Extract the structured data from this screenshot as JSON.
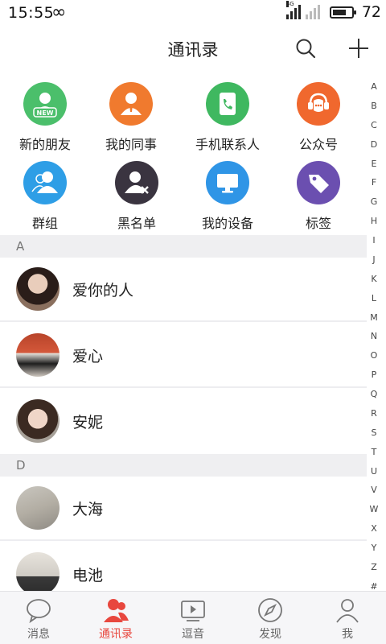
{
  "status_bar": {
    "time": "15:55",
    "inf_symbol": "∞",
    "network_tag": "4G",
    "battery": "72",
    "battery_level": 0.72
  },
  "header": {
    "title": "通讯录"
  },
  "quick_entries": [
    {
      "label": "新的朋友",
      "icon": "new-friend-icon",
      "color": "#4bbf6b"
    },
    {
      "label": "我的同事",
      "icon": "colleague-icon",
      "color": "#f07a2e"
    },
    {
      "label": "手机联系人",
      "icon": "phone-contacts-icon",
      "color": "#3fb860"
    },
    {
      "label": "公众号",
      "icon": "public-account-icon",
      "color": "#f0682e"
    },
    {
      "label": "群组",
      "icon": "group-icon",
      "color": "#2e9ee6"
    },
    {
      "label": "黑名单",
      "icon": "blacklist-icon",
      "color": "#3a3440"
    },
    {
      "label": "我的设备",
      "icon": "device-icon",
      "color": "#2f95e6"
    },
    {
      "label": "标签",
      "icon": "tag-icon",
      "color": "#6b4fb0"
    }
  ],
  "index_letters": [
    "A",
    "B",
    "C",
    "D",
    "E",
    "F",
    "G",
    "H",
    "I",
    "J",
    "K",
    "L",
    "M",
    "N",
    "O",
    "P",
    "Q",
    "R",
    "S",
    "T",
    "U",
    "V",
    "W",
    "X",
    "Y",
    "Z",
    "#"
  ],
  "sections": [
    {
      "letter": "A",
      "contacts": [
        "爱你的人",
        "爱心",
        "安妮"
      ]
    },
    {
      "letter": "D",
      "contacts": [
        "大海",
        "电池"
      ]
    }
  ],
  "new_badge": "NEW",
  "tabs": [
    {
      "label": "消息",
      "icon": "message-icon"
    },
    {
      "label": "通讯录",
      "icon": "contacts-icon",
      "active": true
    },
    {
      "label": "逗音",
      "icon": "video-icon"
    },
    {
      "label": "发现",
      "icon": "compass-icon"
    },
    {
      "label": "我",
      "icon": "profile-icon"
    }
  ],
  "colors": {
    "accent": "#e8473e",
    "section_bg": "#efeff1"
  }
}
